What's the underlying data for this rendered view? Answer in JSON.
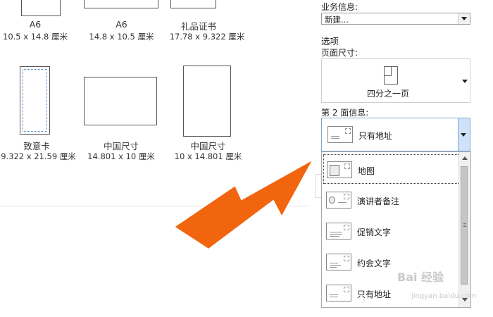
{
  "gallery": {
    "row1": [
      {
        "name": "A6",
        "size": "10.5 x 14.8 厘米"
      },
      {
        "name": "A6",
        "size": "14.8 x 10.5 厘米"
      },
      {
        "name": "礼品证书",
        "size": "17.78 x 9.322 厘米"
      }
    ],
    "row2": [
      {
        "name": "致意卡",
        "size": "9.322 x 21.59 厘米"
      },
      {
        "name": "中国尺寸",
        "size": "14.801 x 10 厘米"
      },
      {
        "name": "中国尺寸",
        "size": "10 x 14.801 厘米"
      }
    ]
  },
  "panel": {
    "business_info_label": "业务信息:",
    "business_info_value": "新建...",
    "options_label": "选项",
    "page_size_label": "页面尺寸:",
    "page_size_value": "四分之一页",
    "face2_label": "第 2 面信息:",
    "face2_value": "只有地址"
  },
  "dropdown": {
    "items": [
      {
        "label": "地图",
        "icon": "map-card-icon",
        "selected": true
      },
      {
        "label": "演讲者备注",
        "icon": "speaker-notes-card-icon",
        "selected": false
      },
      {
        "label": "促销文字",
        "icon": "promo-text-card-icon",
        "selected": false
      },
      {
        "label": "约会文字",
        "icon": "appointment-text-card-icon",
        "selected": false
      },
      {
        "label": "只有地址",
        "icon": "address-only-card-icon",
        "selected": false
      }
    ]
  },
  "annotation": {
    "color": "#f2650f",
    "icon": "pointing-arrow"
  },
  "watermark": {
    "text": "Bai 经验",
    "sub": "jingyan.baidu.com"
  }
}
